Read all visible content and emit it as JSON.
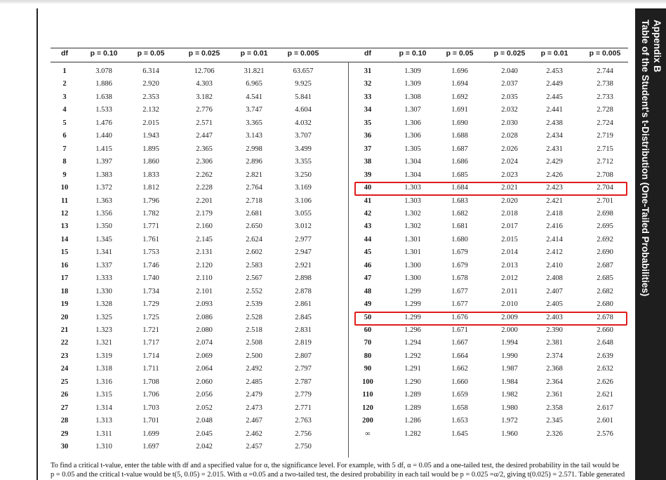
{
  "appendix": {
    "label": "Appendix B",
    "title": "Table of the Student's t-Distribution (One-Tailed Probabilities)"
  },
  "columns": [
    "df",
    "p = 0.10",
    "p = 0.05",
    "p = 0.025",
    "p = 0.01",
    "p = 0.005"
  ],
  "left_rows": [
    [
      "1",
      "3.078",
      "6.314",
      "12.706",
      "31.821",
      "63.657"
    ],
    [
      "2",
      "1.886",
      "2.920",
      "4.303",
      "6.965",
      "9.925"
    ],
    [
      "3",
      "1.638",
      "2.353",
      "3.182",
      "4.541",
      "5.841"
    ],
    [
      "4",
      "1.533",
      "2.132",
      "2.776",
      "3.747",
      "4.604"
    ],
    [
      "5",
      "1.476",
      "2.015",
      "2.571",
      "3.365",
      "4.032"
    ],
    [
      "6",
      "1.440",
      "1.943",
      "2.447",
      "3.143",
      "3.707"
    ],
    [
      "7",
      "1.415",
      "1.895",
      "2.365",
      "2.998",
      "3.499"
    ],
    [
      "8",
      "1.397",
      "1.860",
      "2.306",
      "2.896",
      "3.355"
    ],
    [
      "9",
      "1.383",
      "1.833",
      "2.262",
      "2.821",
      "3.250"
    ],
    [
      "10",
      "1.372",
      "1.812",
      "2.228",
      "2.764",
      "3.169"
    ],
    [
      "11",
      "1.363",
      "1.796",
      "2.201",
      "2.718",
      "3.106"
    ],
    [
      "12",
      "1.356",
      "1.782",
      "2.179",
      "2.681",
      "3.055"
    ],
    [
      "13",
      "1.350",
      "1.771",
      "2.160",
      "2.650",
      "3.012"
    ],
    [
      "14",
      "1.345",
      "1.761",
      "2.145",
      "2.624",
      "2.977"
    ],
    [
      "15",
      "1.341",
      "1.753",
      "2.131",
      "2.602",
      "2.947"
    ],
    [
      "16",
      "1.337",
      "1.746",
      "2.120",
      "2.583",
      "2.921"
    ],
    [
      "17",
      "1.333",
      "1.740",
      "2.110",
      "2.567",
      "2.898"
    ],
    [
      "18",
      "1.330",
      "1.734",
      "2.101",
      "2.552",
      "2.878"
    ],
    [
      "19",
      "1.328",
      "1.729",
      "2.093",
      "2.539",
      "2.861"
    ],
    [
      "20",
      "1.325",
      "1.725",
      "2.086",
      "2.528",
      "2.845"
    ],
    [
      "21",
      "1.323",
      "1.721",
      "2.080",
      "2.518",
      "2.831"
    ],
    [
      "22",
      "1.321",
      "1.717",
      "2.074",
      "2.508",
      "2.819"
    ],
    [
      "23",
      "1.319",
      "1.714",
      "2.069",
      "2.500",
      "2.807"
    ],
    [
      "24",
      "1.318",
      "1.711",
      "2.064",
      "2.492",
      "2.797"
    ],
    [
      "25",
      "1.316",
      "1.708",
      "2.060",
      "2.485",
      "2.787"
    ],
    [
      "26",
      "1.315",
      "1.706",
      "2.056",
      "2.479",
      "2.779"
    ],
    [
      "27",
      "1.314",
      "1.703",
      "2.052",
      "2.473",
      "2.771"
    ],
    [
      "28",
      "1.313",
      "1.701",
      "2.048",
      "2.467",
      "2.763"
    ],
    [
      "29",
      "1.311",
      "1.699",
      "2.045",
      "2.462",
      "2.756"
    ],
    [
      "30",
      "1.310",
      "1.697",
      "2.042",
      "2.457",
      "2.750"
    ]
  ],
  "right_rows": [
    [
      "31",
      "1.309",
      "1.696",
      "2.040",
      "2.453",
      "2.744"
    ],
    [
      "32",
      "1.309",
      "1.694",
      "2.037",
      "2.449",
      "2.738"
    ],
    [
      "33",
      "1.308",
      "1.692",
      "2.035",
      "2.445",
      "2.733"
    ],
    [
      "34",
      "1.307",
      "1.691",
      "2.032",
      "2.441",
      "2.728"
    ],
    [
      "35",
      "1.306",
      "1.690",
      "2.030",
      "2.438",
      "2.724"
    ],
    [
      "36",
      "1.306",
      "1.688",
      "2.028",
      "2.434",
      "2.719"
    ],
    [
      "37",
      "1.305",
      "1.687",
      "2.026",
      "2.431",
      "2.715"
    ],
    [
      "38",
      "1.304",
      "1.686",
      "2.024",
      "2.429",
      "2.712"
    ],
    [
      "39",
      "1.304",
      "1.685",
      "2.023",
      "2.426",
      "2.708"
    ],
    [
      "40",
      "1.303",
      "1.684",
      "2.021",
      "2.423",
      "2.704"
    ],
    [
      "41",
      "1.303",
      "1.683",
      "2.020",
      "2.421",
      "2.701"
    ],
    [
      "42",
      "1.302",
      "1.682",
      "2.018",
      "2.418",
      "2.698"
    ],
    [
      "43",
      "1.302",
      "1.681",
      "2.017",
      "2.416",
      "2.695"
    ],
    [
      "44",
      "1.301",
      "1.680",
      "2.015",
      "2.414",
      "2.692"
    ],
    [
      "45",
      "1.301",
      "1.679",
      "2.014",
      "2.412",
      "2.690"
    ],
    [
      "46",
      "1.300",
      "1.679",
      "2.013",
      "2.410",
      "2.687"
    ],
    [
      "47",
      "1.300",
      "1.678",
      "2.012",
      "2.408",
      "2.685"
    ],
    [
      "48",
      "1.299",
      "1.677",
      "2.011",
      "2.407",
      "2.682"
    ],
    [
      "49",
      "1.299",
      "1.677",
      "2.010",
      "2.405",
      "2.680"
    ],
    [
      "50",
      "1.299",
      "1.676",
      "2.009",
      "2.403",
      "2.678"
    ],
    [
      "60",
      "1.296",
      "1.671",
      "2.000",
      "2.390",
      "2.660"
    ],
    [
      "70",
      "1.294",
      "1.667",
      "1.994",
      "2.381",
      "2.648"
    ],
    [
      "80",
      "1.292",
      "1.664",
      "1.990",
      "2.374",
      "2.639"
    ],
    [
      "90",
      "1.291",
      "1.662",
      "1.987",
      "2.368",
      "2.632"
    ],
    [
      "100",
      "1.290",
      "1.660",
      "1.984",
      "2.364",
      "2.626"
    ],
    [
      "110",
      "1.289",
      "1.659",
      "1.982",
      "2.361",
      "2.621"
    ],
    [
      "120",
      "1.289",
      "1.658",
      "1.980",
      "2.358",
      "2.617"
    ],
    [
      "200",
      "1.286",
      "1.653",
      "1.972",
      "2.345",
      "2.601"
    ],
    [
      "∞",
      "1.282",
      "1.645",
      "1.960",
      "2.326",
      "2.576"
    ]
  ],
  "highlighted_df": [
    "40",
    "50"
  ],
  "highlight_color": "#e01b1b",
  "footnote": {
    "line1": "To find a critical t-value, enter the table with df and a specified value for α, the significance level. For example, with 5 df, α = 0.05 and a one-tailed test, the desired probability in the tail would be",
    "line2": "p = 0.05 and the critical t-value would be t(5, 0.05) = 2.015. With α =0.05 and a two-tailed test, the desired probability in each tail would be p = 0.025 =α/2, giving t(0.025) = 2.571. Table generated"
  }
}
